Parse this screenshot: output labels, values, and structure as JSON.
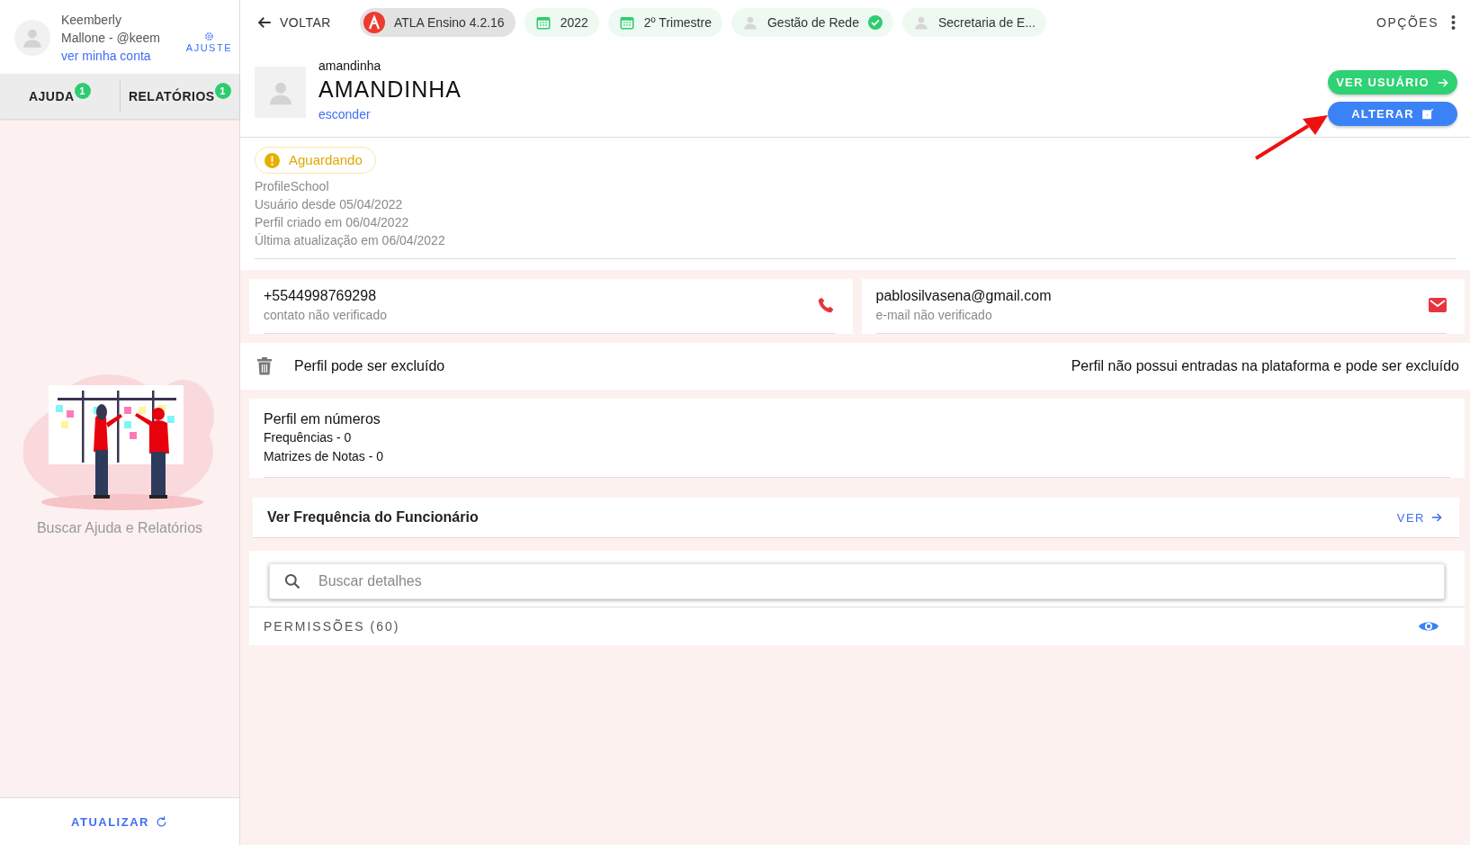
{
  "sidebar": {
    "user": {
      "name": "Keemberly Mallone - @keem",
      "link": "ver minha conta"
    },
    "settings_label": "AJUSTE",
    "tabs": [
      {
        "label": "AJUDA",
        "badge": "1"
      },
      {
        "label": "RELATÓRIOS",
        "badge": "1"
      }
    ],
    "empty_state": {
      "caption": "Buscar Ajuda e Relatórios"
    },
    "refresh_button": "ATUALIZAR"
  },
  "topbar": {
    "back": "VOLTAR",
    "chips": [
      {
        "kind": "app",
        "label": "ATLA Ensino 4.2.16",
        "verified": false
      },
      {
        "kind": "calendar",
        "label": "2022",
        "verified": false
      },
      {
        "kind": "calendar",
        "label": "2º Trimestre",
        "verified": false
      },
      {
        "kind": "person",
        "label": "Gestão de Rede",
        "verified": true
      },
      {
        "kind": "person",
        "label": "Secretaria de E...",
        "verified": false
      }
    ],
    "options": "OPÇÕES"
  },
  "profile": {
    "username": "amandinha",
    "name": "AMANDINHA",
    "toggle_link": "esconder",
    "actions": [
      {
        "kind": "view",
        "label": "VER USUÁRIO"
      },
      {
        "kind": "edit",
        "label": "ALTERAR"
      }
    ],
    "status": "Aguardando",
    "details": [
      "ProfileSchool",
      "Usuário desde 05/04/2022",
      "Perfil criado em 06/04/2022",
      "Última atualização em 06/04/2022"
    ]
  },
  "contacts": [
    {
      "kind": "phone",
      "value": "+5544998769298",
      "note": "contato não verificado"
    },
    {
      "kind": "email",
      "value": "pablosilvasena@gmail.com",
      "note": "e-mail não verificado"
    }
  ],
  "deletion": {
    "title": "Perfil pode ser excluído",
    "message": "Perfil não possui entradas na plataforma e pode ser excluído"
  },
  "stats": {
    "title": "Perfil em números",
    "items": [
      "Frequências - 0",
      "Matrizes de Notas - 0"
    ]
  },
  "attendance_link": {
    "title": "Ver Frequência do Funcionário",
    "action": "VER"
  },
  "search": {
    "placeholder": "Buscar detalhes"
  },
  "permissions": {
    "label": "PERMISSÕES (60)"
  }
}
